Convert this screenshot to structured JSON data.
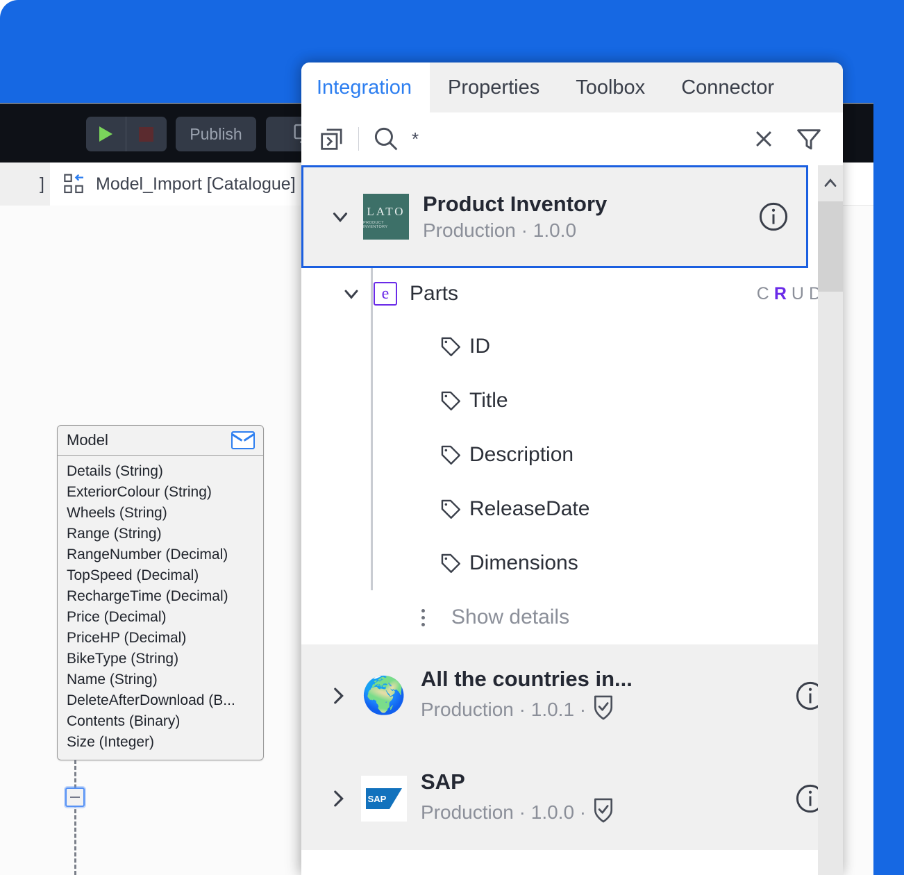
{
  "colors": {
    "desktop_blue": "#1668e3",
    "accent_blue": "#2c7ef0",
    "selection_blue": "#1b5fe0",
    "entity_purple": "#6a2ae8",
    "lato_green": "#3d7068",
    "muted_grey": "#8b8f99"
  },
  "ide": {
    "toolbar": {
      "run_icon": "play-icon",
      "stop_icon": "stop-icon",
      "publish_label": "Publish",
      "preview_icon": "monitor-icon"
    },
    "tabs": {
      "partial_label": "]",
      "active_icon": "domain-model-icon",
      "active_label": "Model_Import [Catalogue]"
    },
    "entity": {
      "title": "Model",
      "header_icon": "envelope-icon",
      "attributes": [
        "Details (String)",
        "ExteriorColour (String)",
        "Wheels (String)",
        "Range (String)",
        "RangeNumber (Decimal)",
        "TopSpeed (Decimal)",
        "RechargeTime (Decimal)",
        "Price (Decimal)",
        "PriceHP (Decimal)",
        "BikeType (String)",
        "Name (String)",
        "DeleteAfterDownload (B...",
        "Contents (Binary)",
        "Size (Integer)"
      ],
      "collapse_icon": "collapse-minus-icon"
    }
  },
  "panel": {
    "tabs": [
      {
        "label": "Integration",
        "active": true
      },
      {
        "label": "Properties",
        "active": false
      },
      {
        "label": "Toolbox",
        "active": false
      },
      {
        "label": "Connector",
        "active": false
      }
    ],
    "search": {
      "expand_icon": "expand-all-icon",
      "search_icon": "search-icon",
      "value": "*",
      "placeholder": "*",
      "clear_icon": "close-icon",
      "filter_icon": "filter-icon"
    },
    "scrollbar": {
      "up_icon": "chevron-up-icon"
    },
    "packages": [
      {
        "name": "Product Inventory",
        "environment": "Production",
        "version": "1.0.0",
        "meta": "Production · 1.0.0",
        "verified": false,
        "selected": true,
        "expanded": true,
        "caret_icon": "chevron-down-icon",
        "logo": "lato-logo",
        "logo_text": "LATO",
        "logo_subtext": "PRODUCT INVENTORY",
        "info_icon": "info-icon",
        "entities": [
          {
            "name": "Parts",
            "icon": "entity-e-icon",
            "caret_icon": "chevron-down-icon",
            "crud": {
              "create": "C",
              "read": "R",
              "update": "U",
              "delete": "D",
              "enabled": "R"
            },
            "attributes": [
              {
                "name": "ID",
                "icon": "tag-icon"
              },
              {
                "name": "Title",
                "icon": "tag-icon"
              },
              {
                "name": "Description",
                "icon": "tag-icon"
              },
              {
                "name": "ReleaseDate",
                "icon": "tag-icon"
              },
              {
                "name": "Dimensions",
                "icon": "tag-icon"
              }
            ],
            "details_label": "Show details",
            "details_icon": "kebab-menu-icon"
          }
        ]
      },
      {
        "name": "All the countries in...",
        "environment": "Production",
        "version": "1.0.1",
        "meta": "Production · 1.0.1 ·",
        "verified": true,
        "verified_icon": "shield-check-icon",
        "selected": false,
        "expanded": false,
        "caret_icon": "chevron-right-icon",
        "logo": "globe-logo",
        "logo_glyph": "🌍",
        "info_icon": "info-icon"
      },
      {
        "name": "SAP",
        "environment": "Production",
        "version": "1.0.0",
        "meta": "Production · 1.0.0 ·",
        "verified": true,
        "verified_icon": "shield-check-icon",
        "selected": false,
        "expanded": false,
        "caret_icon": "chevron-right-icon",
        "logo": "sap-logo",
        "logo_text": "SAP",
        "info_icon": "info-icon"
      }
    ]
  }
}
